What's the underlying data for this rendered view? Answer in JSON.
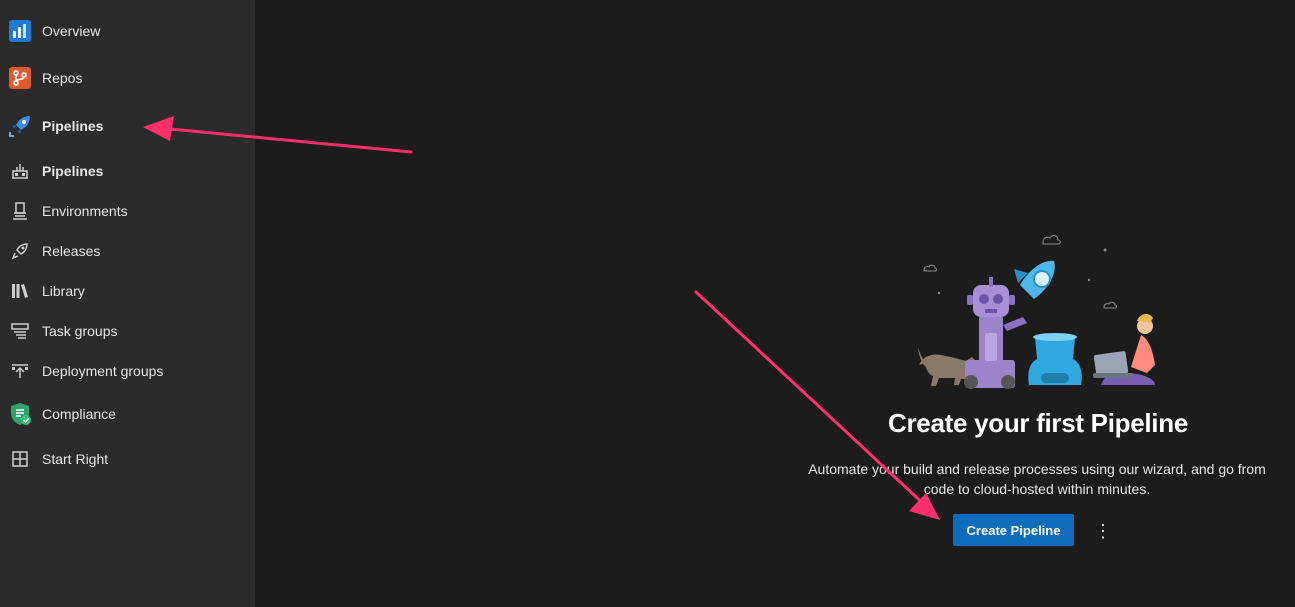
{
  "sidebar": {
    "items": [
      {
        "label": "Overview",
        "icon": "overview-icon"
      },
      {
        "label": "Repos",
        "icon": "repos-icon"
      },
      {
        "label": "Pipelines",
        "icon": "pipelines-rocket-icon"
      },
      {
        "label": "Pipelines",
        "icon": "pipelines-icon"
      },
      {
        "label": "Environments",
        "icon": "environments-icon"
      },
      {
        "label": "Releases",
        "icon": "releases-icon"
      },
      {
        "label": "Library",
        "icon": "library-icon"
      },
      {
        "label": "Task groups",
        "icon": "task-groups-icon"
      },
      {
        "label": "Deployment groups",
        "icon": "deployment-groups-icon"
      },
      {
        "label": "Compliance",
        "icon": "compliance-shield-icon"
      },
      {
        "label": "Start Right",
        "icon": "start-right-icon"
      }
    ]
  },
  "main": {
    "title": "Create your first Pipeline",
    "description_line1": "Automate your build and release processes using our wizard, and go from",
    "description_line2": "code to cloud-hosted within minutes.",
    "create_button": "Create Pipeline",
    "more_button": "⋮"
  },
  "colors": {
    "sidebar_bg": "#2b2b2b",
    "main_bg": "#1c1c1c",
    "accent": "#0f6cbd",
    "annotation_arrow": "#ff2e6e"
  }
}
